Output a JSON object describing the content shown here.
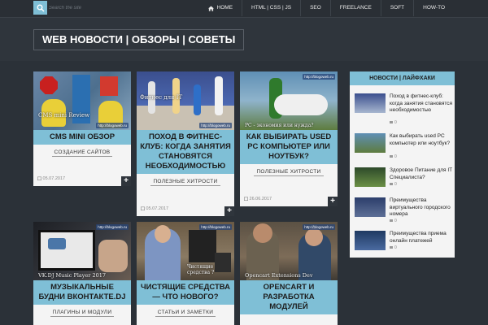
{
  "topbar": {
    "search_placeholder": "Search the site",
    "nav": [
      {
        "label": "HOME",
        "icon": "home-icon"
      },
      {
        "label": "HTML | CSS | JS"
      },
      {
        "label": "SEO"
      },
      {
        "label": "FREELANCE"
      },
      {
        "label": "SOFT"
      },
      {
        "label": "HOW-to"
      }
    ]
  },
  "header": {
    "site_title": "WEB НОВОСТИ | ОБЗОРЫ | СОВЕТЫ"
  },
  "colors": {
    "accent": "#7fbfd6",
    "background": "#2b3138",
    "card": "#f4f4f4"
  },
  "cards": [
    {
      "title": "CMS MINI ОБЗОР",
      "category": "СОЗДАНИЕ САЙТОВ",
      "date": "05.07.2017",
      "thumb_caption": "CMS mini Review",
      "watermark": "http://blogoweb.ru"
    },
    {
      "title": "ПОХОД В ФИТНЕС-КЛУБ: КОГДА ЗАНЯТИЯ СТАНОВЯТСЯ НЕОБХОДИМОСТЬЮ",
      "category": "ПОЛЕЗНЫЕ ХИТРОСТИ",
      "date": "05.07.2017",
      "thumb_caption": "Фитнес для IT",
      "watermark": "http://blogoweb.ru"
    },
    {
      "title": "КАК ВЫБИРАТЬ USED PC КОМПЬЮТЕР ИЛИ НОУТБУК?",
      "category": "ПОЛЕЗНЫЕ ХИТРОСТИ",
      "date": "26.06.2017",
      "thumb_caption": "PC - экономия или нужда?",
      "watermark": "http://blogoweb.ru"
    },
    {
      "title": "МУЗЫКАЛЬНЫЕ БУДНИ ВКОНТАКТЕ.DJ",
      "category": "ПЛАГИНЫ И МОДУЛИ",
      "thumb_caption": "VK.DJ Music Player 2017",
      "watermark": "http://blogoweb.ru"
    },
    {
      "title": "ЧИСТЯЩИЕ СРЕДСТВА — ЧТО НОВОГО?",
      "category": "СТАТЬИ И ЗАМЕТКИ",
      "thumb_caption": "Чистящие средства ?",
      "watermark": "http://blogoweb.ru"
    },
    {
      "title": "OPENCART И РАЗРАБОТКА МОДУЛЕЙ",
      "thumb_caption": "Opencart Extensions Dev",
      "watermark": "http://blogoweb.ru"
    }
  ],
  "sidebar": {
    "heading": "НОВОСТИ | ЛАЙФХАКИ",
    "items": [
      {
        "title": "Поход в фитнес-клуб: когда занятия становятся необходимостью",
        "comments": "0"
      },
      {
        "title": "Как выбирать used PC компьютер или ноутбук?",
        "comments": "0"
      },
      {
        "title": "Здоровое Питание для IT Специалиста?",
        "comments": "0"
      },
      {
        "title": "Преимущества виртуального городского номера",
        "comments": "0"
      },
      {
        "title": "Преимущества приема онлайн платежей",
        "comments": "0"
      }
    ]
  }
}
